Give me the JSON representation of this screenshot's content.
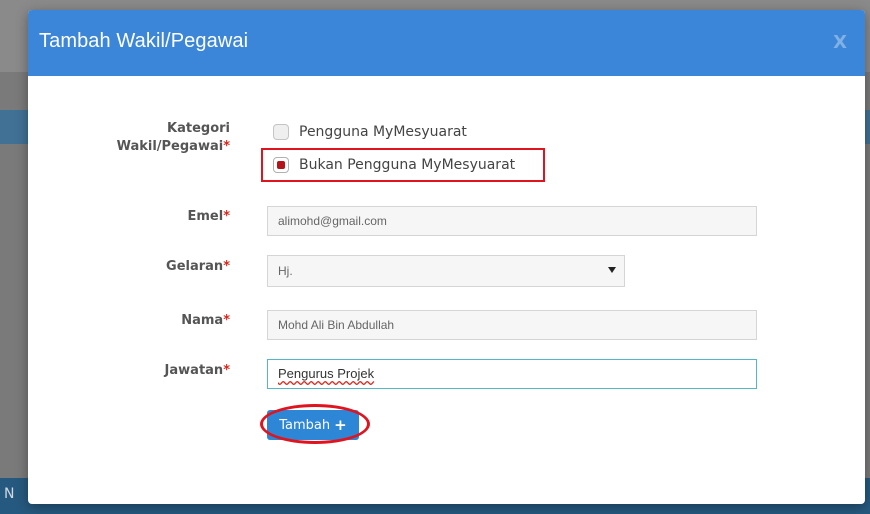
{
  "modal": {
    "title": "Tambah Wakil/Pegawai",
    "close_label": "X"
  },
  "form": {
    "kategori": {
      "label_line1": "Kategori",
      "label_line2": "Wakil/Pegawai",
      "required_mark": "*",
      "options": [
        {
          "label": "Pengguna MyMesyuarat",
          "selected": false
        },
        {
          "label": "Bukan Pengguna MyMesyuarat",
          "selected": true
        }
      ]
    },
    "emel": {
      "label": "Emel",
      "required_mark": "*",
      "placeholder": "alimohd@gmail.com"
    },
    "gelaran": {
      "label": "Gelaran",
      "required_mark": "*",
      "selected": "Hj."
    },
    "nama": {
      "label": "Nama",
      "required_mark": "*",
      "placeholder": "Mohd Ali Bin Abdullah"
    },
    "jawatan": {
      "label": "Jawatan",
      "required_mark": "*",
      "value": "Pengurus Projek"
    },
    "submit": {
      "label": "Tambah",
      "icon": "plus-icon"
    }
  },
  "background": {
    "corner_letter": "N"
  },
  "colors": {
    "header": "#3b86d8",
    "button": "#2d86d6",
    "highlight": "#e0141e",
    "required": "#d9261c",
    "active_border": "#53b7c6"
  }
}
